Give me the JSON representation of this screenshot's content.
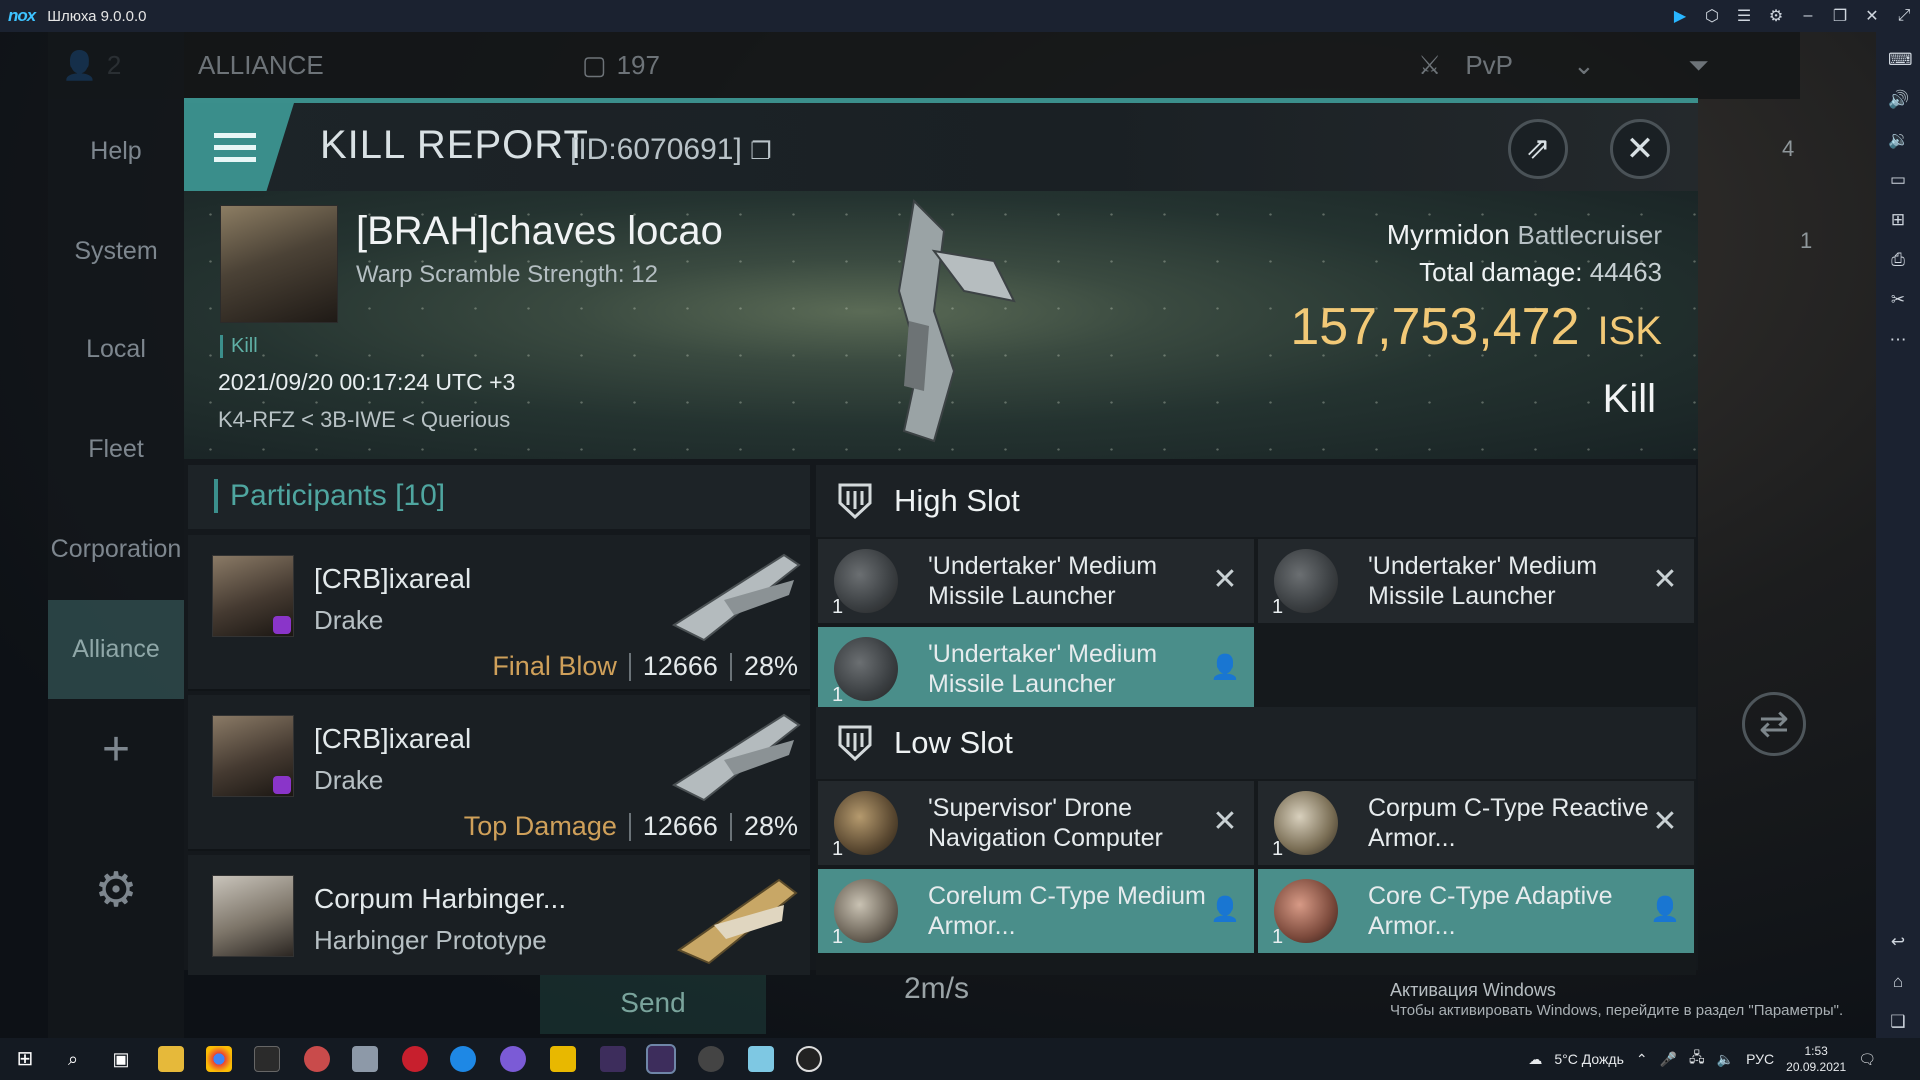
{
  "emulator": {
    "logo": "nox",
    "title": "Шлюха 9.0.0.0",
    "icons": [
      "play-icon",
      "hex-icon",
      "menu-icon",
      "gear-icon",
      "minimize-icon",
      "restore-icon",
      "close-icon",
      "fullscreen-icon"
    ]
  },
  "background_ui": {
    "count": "2",
    "channel": "ALLIANCE",
    "channel_count": "197",
    "pvp_label": "PvP",
    "nav": [
      "Help",
      "System",
      "Local",
      "Fleet",
      "Corporation",
      "Alliance"
    ],
    "active_nav": "Alliance",
    "send": "Send",
    "speed": "2m/s",
    "right_badges": [
      "4",
      "1"
    ]
  },
  "panel": {
    "title": "KILL REPORT",
    "id": "[ID:6070691]"
  },
  "victim": {
    "name": "[BRAH]chaves locao",
    "subtitle": "Warp Scramble Strength: 12",
    "tag": "Kill",
    "time": "2021/09/20 00:17:24 UTC +3",
    "location": "K4-RFZ < 3B-IWE < Querious",
    "ship": "Myrmidon",
    "ship_class": "Battlecruiser",
    "damage_label": "Total damage:",
    "damage": "44463",
    "isk": "157,753,472",
    "isk_unit": "ISK",
    "result": "Kill"
  },
  "participants": {
    "title": "Participants",
    "count": "[10]",
    "rows": [
      {
        "name": "[CRB]ixareal",
        "ship": "Drake",
        "label": "Final Blow",
        "damage": "12666",
        "pct": "28%"
      },
      {
        "name": "[CRB]ixareal",
        "ship": "Drake",
        "label": "Top Damage",
        "damage": "12666",
        "pct": "28%"
      },
      {
        "name": "Corpum Harbinger...",
        "ship": "Harbinger Prototype",
        "label": "",
        "damage": "",
        "pct": ""
      }
    ]
  },
  "high_slot": {
    "title": "High Slot",
    "modules": [
      {
        "name": "'Undertaker' Medium Missile Launcher",
        "qty": "1",
        "status": "destroyed"
      },
      {
        "name": "'Undertaker' Medium Missile Launcher",
        "qty": "1",
        "status": "destroyed"
      },
      {
        "name": "'Undertaker' Medium Missile Launcher",
        "qty": "1",
        "status": "dropped"
      }
    ]
  },
  "low_slot": {
    "title": "Low Slot",
    "modules": [
      {
        "name": "'Supervisor' Drone Navigation Computer",
        "qty": "1",
        "status": "destroyed"
      },
      {
        "name": "Corpum C-Type Reactive Armor...",
        "qty": "1",
        "status": "destroyed"
      },
      {
        "name": "Corelum C-Type Medium Armor...",
        "qty": "1",
        "status": "dropped"
      },
      {
        "name": "Core C-Type Adaptive Armor...",
        "qty": "1",
        "status": "dropped"
      }
    ]
  },
  "windows": {
    "activation_title": "Активация Windows",
    "activation_text": "Чтобы активировать Windows, перейдите в раздел \"Параметры\".",
    "weather": "5°C  Дождь",
    "lang": "РУС",
    "time": "1:53",
    "date": "20.09.2021"
  },
  "colors": {
    "accent": "#3b8f8c",
    "isk": "#f2c977",
    "dropped": "#4a8e8a",
    "highlight": "#cfa05a"
  }
}
